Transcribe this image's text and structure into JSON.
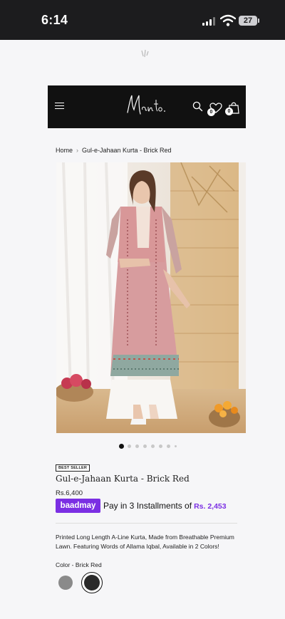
{
  "status_bar": {
    "time": "6:14",
    "battery": "27"
  },
  "header": {
    "logo_text": "Manto.",
    "wishlist_count": "0",
    "cart_count": "0"
  },
  "breadcrumb": {
    "home": "Home",
    "separator": "›",
    "current": "Gul-e-Jahaan Kurta - Brick Red"
  },
  "gallery": {
    "slide_count": 8,
    "active_index": 0
  },
  "product": {
    "badge": "BEST SELLER",
    "title": "Gul-e-Jahaan Kurta - Brick Red",
    "price": "Rs.6,400",
    "bnpl": {
      "logo": "baadmay",
      "text": "Pay in 3 Installments of",
      "amount": "Rs. 2,453",
      "brand_color": "#7b2fe3"
    },
    "description": "Printed Long Length A-Line Kurta, Made from Breathable Premium Lawn. Featuring Words of Allama Iqbal, Available in 2 Colors!",
    "color_label": "Color - Brick Red",
    "colors": [
      "#8a8a8a",
      "#2a2a2a"
    ]
  }
}
